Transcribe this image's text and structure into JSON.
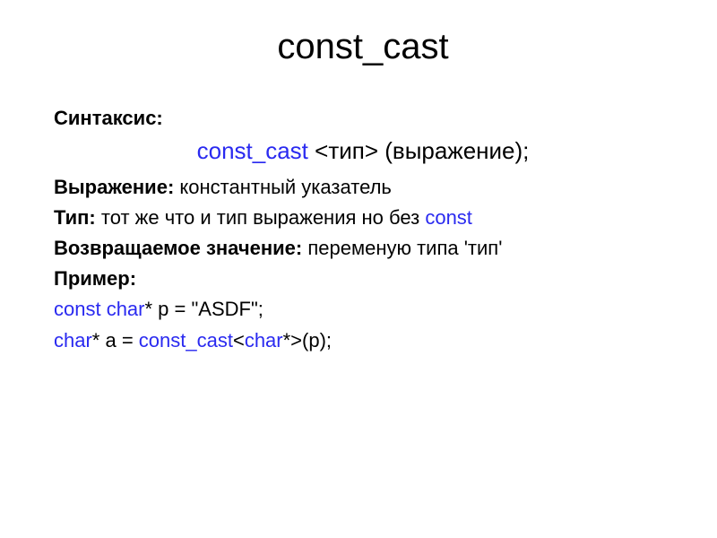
{
  "title": "const_cast",
  "labels": {
    "syntax": "Синтаксис:",
    "expression": "Выражение:",
    "type": "Тип:",
    "return": "Возвращаемое значение:",
    "example": "Пример:"
  },
  "syntax_line": {
    "kw": "const_cast",
    "rest": " <тип> (выражение);"
  },
  "expression_text": " константный указатель",
  "type_text_pre": " тот же что и тип выражения но без ",
  "type_kw": "const",
  "return_text": "  переменую типа 'тип'",
  "code": {
    "l1_kw": "const char",
    "l1_rest": "* p = \"ASDF\";",
    "l2_kw1": "char",
    "l2_mid": "* a = ",
    "l2_kw2": "const_cast",
    "l2_ang_open": "<",
    "l2_kw3": "char",
    "l2_rest": "*>(p);"
  }
}
